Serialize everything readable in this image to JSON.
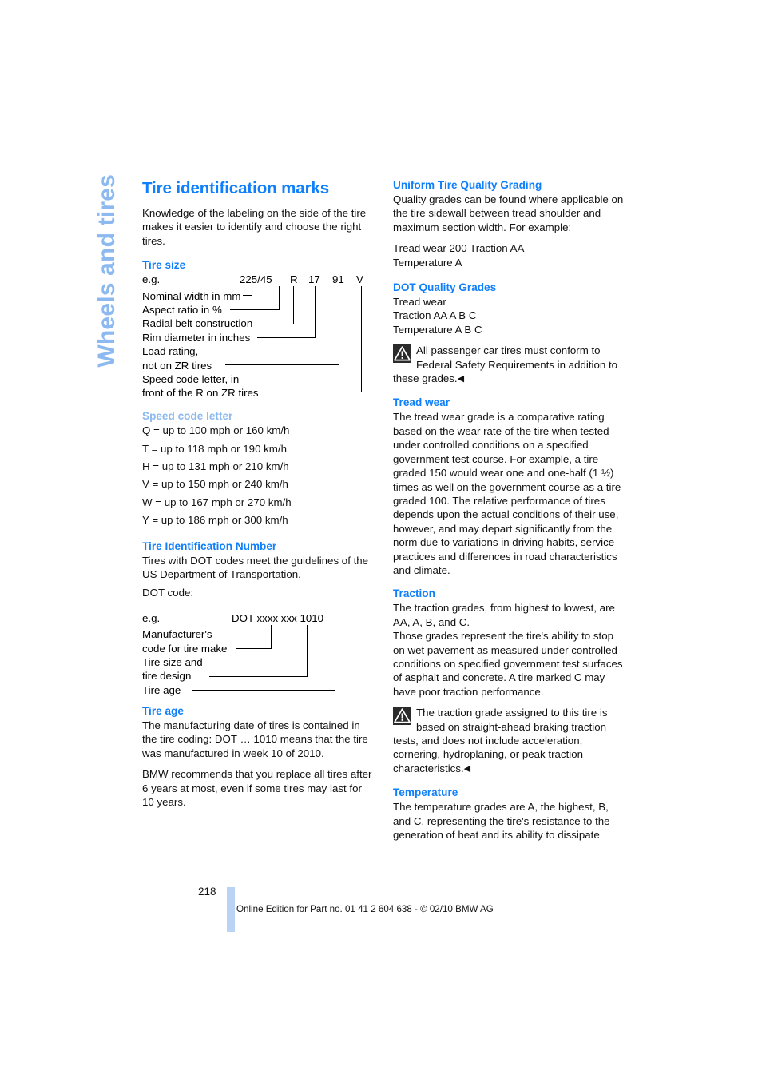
{
  "chapter_tab": "Wheels and tires",
  "title": "Tire identification marks",
  "intro": "Knowledge of the labeling on the side of the tire makes it easier to identify and choose the right tires.",
  "tire_size": {
    "heading": "Tire size",
    "eg_label": "e.g.",
    "code": "225/45  R  17  91   V",
    "code_parts": [
      "225/45",
      "R",
      "17",
      "91",
      "V"
    ],
    "labels": [
      "Nominal width in mm",
      "Aspect ratio in %",
      "Radial belt construction",
      "Rim diameter in inches",
      "Load rating,",
      "not on ZR tires",
      "Speed code letter, in",
      "front of the R on ZR tires"
    ]
  },
  "speed_code": {
    "heading": "Speed code letter",
    "entries": [
      "Q = up to 100 mph or 160 km/h",
      "T = up to 118 mph or 190 km/h",
      "H = up to 131 mph or 210 km/h",
      "V = up to 150 mph or 240 km/h",
      "W = up to 167 mph or 270 km/h",
      "Y = up to 186 mph or 300 km/h"
    ]
  },
  "tin": {
    "heading": "Tire Identification Number",
    "body": "Tires with DOT codes meet the guidelines of the US Department of Transportation.",
    "dot_label": "DOT code:",
    "eg_label": "e.g.",
    "code": "DOT xxxx xxx 1010",
    "labels": [
      "Manufacturer's",
      "code for tire make",
      "Tire size and",
      "tire design",
      "Tire age"
    ]
  },
  "tire_age": {
    "heading": "Tire age",
    "p1": "The manufacturing date of tires is contained in the tire coding: DOT … 1010 means that the tire was manufactured in week 10 of 2010.",
    "p2": "BMW recommends that you replace all tires after 6 years at most, even if some tires may last for 10 years."
  },
  "utqg": {
    "heading": "Uniform Tire Quality Grading",
    "p1": "Quality grades can be found where applicable on the tire sidewall between tread shoulder and maximum section width. For example:",
    "example_line1": "Tread wear 200 Traction AA",
    "example_line2": "Temperature A"
  },
  "dot_grades": {
    "heading": "DOT Quality Grades",
    "line1": "Tread wear",
    "line2": "Traction AA A B C",
    "line3": "Temperature A B C",
    "warning": "All passenger car tires must conform to Federal Safety Requirements in addition to these grades.",
    "end_marker": "◀"
  },
  "tread_wear": {
    "heading": "Tread wear",
    "body": "The tread wear grade is a comparative rating based on the wear rate of the tire when tested under controlled conditions on a specified government test course. For example, a tire graded 150 would wear one and one-half (1 ½) times as well on the government course as a tire graded 100. The relative performance of tires depends upon the actual conditions of their use, however, and may depart significantly from the norm due to variations in driving habits, service practices and differences in road characteristics and climate."
  },
  "traction": {
    "heading": "Traction",
    "p1": "The traction grades, from highest to lowest, are AA, A, B, and C.",
    "p2": "Those grades represent the tire's ability to stop on wet pavement as measured under controlled conditions on specified government test surfaces of asphalt and concrete. A tire marked C may have poor traction performance.",
    "warning": "The traction grade assigned to this tire is based on straight-ahead braking traction tests, and does not include acceleration, cornering, hydroplaning, or peak traction characteristics.",
    "end_marker": "◀"
  },
  "temperature": {
    "heading": "Temperature",
    "body": "The temperature grades are A, the highest, B, and C, representing the tire's resistance to the generation of heat and its ability to dissipate"
  },
  "footer": {
    "page_number": "218",
    "note": "Online Edition for Part no. 01 41 2 604 638 - © 02/10 BMW AG"
  },
  "colors": {
    "heading_blue": "#0f7ffb",
    "light_blue": "#8cb9f0",
    "footer_bar": "#b9d4f5"
  }
}
